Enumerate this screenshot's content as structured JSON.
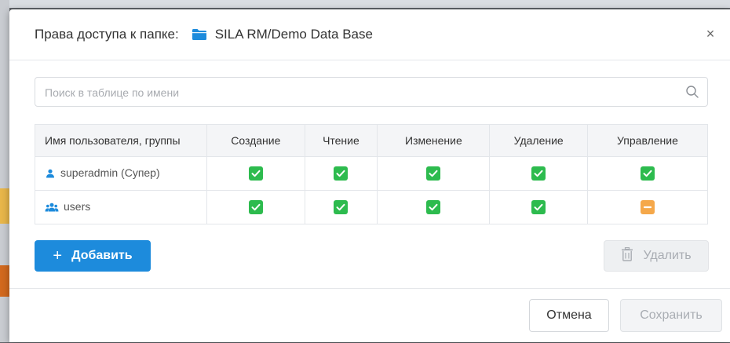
{
  "dialog": {
    "title_label": "Права доступа к папке:",
    "folder_path": "SILA RM/Demo Data Base",
    "close_glyph": "×"
  },
  "search": {
    "placeholder": "Поиск в таблице по имени",
    "value": ""
  },
  "table": {
    "headers": [
      "Имя пользователя, группы",
      "Создание",
      "Чтение",
      "Изменение",
      "Удаление",
      "Управление"
    ],
    "rows": [
      {
        "name": "superadmin (Супер)",
        "icon": "user-icon",
        "perms": [
          "checked",
          "checked",
          "checked",
          "checked",
          "checked"
        ]
      },
      {
        "name": "users",
        "icon": "group-icon",
        "perms": [
          "checked",
          "checked",
          "checked",
          "checked",
          "partial"
        ]
      }
    ]
  },
  "actions": {
    "add_label": "Добавить",
    "add_glyph": "+",
    "delete_label": "Удалить"
  },
  "footer": {
    "cancel_label": "Отмена",
    "save_label": "Сохранить"
  },
  "colors": {
    "primary": "#1d8bdc",
    "checked": "#2dbb4e",
    "partial": "#f5a84a",
    "folder": "#1d8bdc"
  }
}
